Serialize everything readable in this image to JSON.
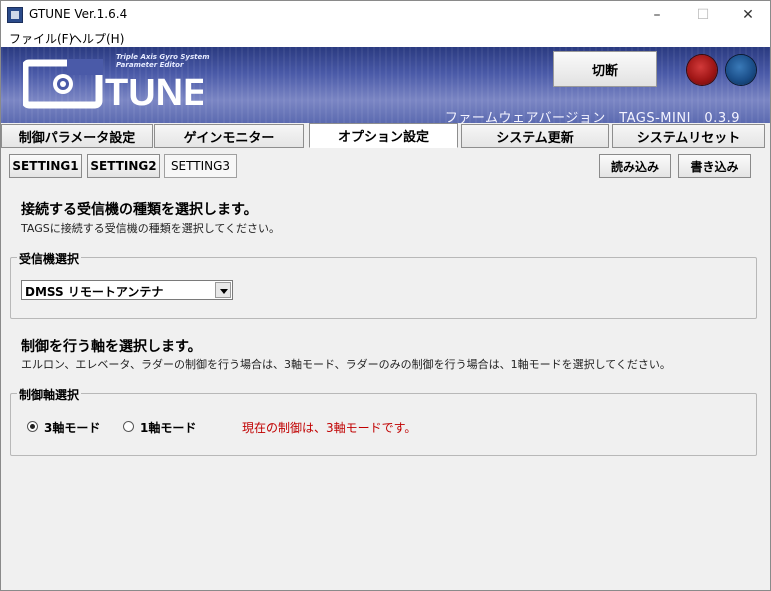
{
  "window": {
    "title": "GTUNE Ver.1.6.4",
    "controls": {
      "minimize": "–",
      "maximize": "☐",
      "close": "✕"
    }
  },
  "menu": [
    "ファイル(F)",
    "ヘルプ(H)"
  ],
  "banner": {
    "logo_text": "TUNE",
    "logo_subtitle_line1": "Triple Axis Gyro System",
    "logo_subtitle_line2": "Parameter Editor",
    "cut_button": "切断",
    "firmware_version": "ファームウェアバージョン　TAGS-MINI　0.3.9",
    "led_colors": {
      "red": "#a01616",
      "blue": "#1b4f8a"
    }
  },
  "tabs": [
    {
      "label": "制御パラメータ設定",
      "active": false
    },
    {
      "label": "ゲインモニター",
      "active": false
    },
    {
      "label": "オプション設定",
      "active": true
    },
    {
      "label": "システム更新",
      "active": false
    },
    {
      "label": "システムリセット",
      "active": false
    }
  ],
  "subtabs": [
    {
      "label": "SETTING1",
      "active": false
    },
    {
      "label": "SETTING2",
      "active": false
    },
    {
      "label": "SETTING3",
      "active": true
    }
  ],
  "actions": {
    "load": "読み込み",
    "write": "書き込み"
  },
  "receiver_section": {
    "title": "接続する受信機の種類を選択します。",
    "description": "TAGSに接続する受信機の種類を選択してください。",
    "group_label": "受信機選択",
    "selected_value": "DMSS リモートアンテナ"
  },
  "axis_section": {
    "title": "制御を行う軸を選択します。",
    "description": "エルロン、エレベータ、ラダーの制御を行う場合は、3軸モード、ラダーのみの制御を行う場合は、1軸モードを選択してください。",
    "group_label": "制御軸選択",
    "options": [
      {
        "label": "3軸モード",
        "checked": true
      },
      {
        "label": "1軸モード",
        "checked": false
      }
    ],
    "status": "現在の制御は、3軸モードです。",
    "status_color": "#c00000"
  }
}
